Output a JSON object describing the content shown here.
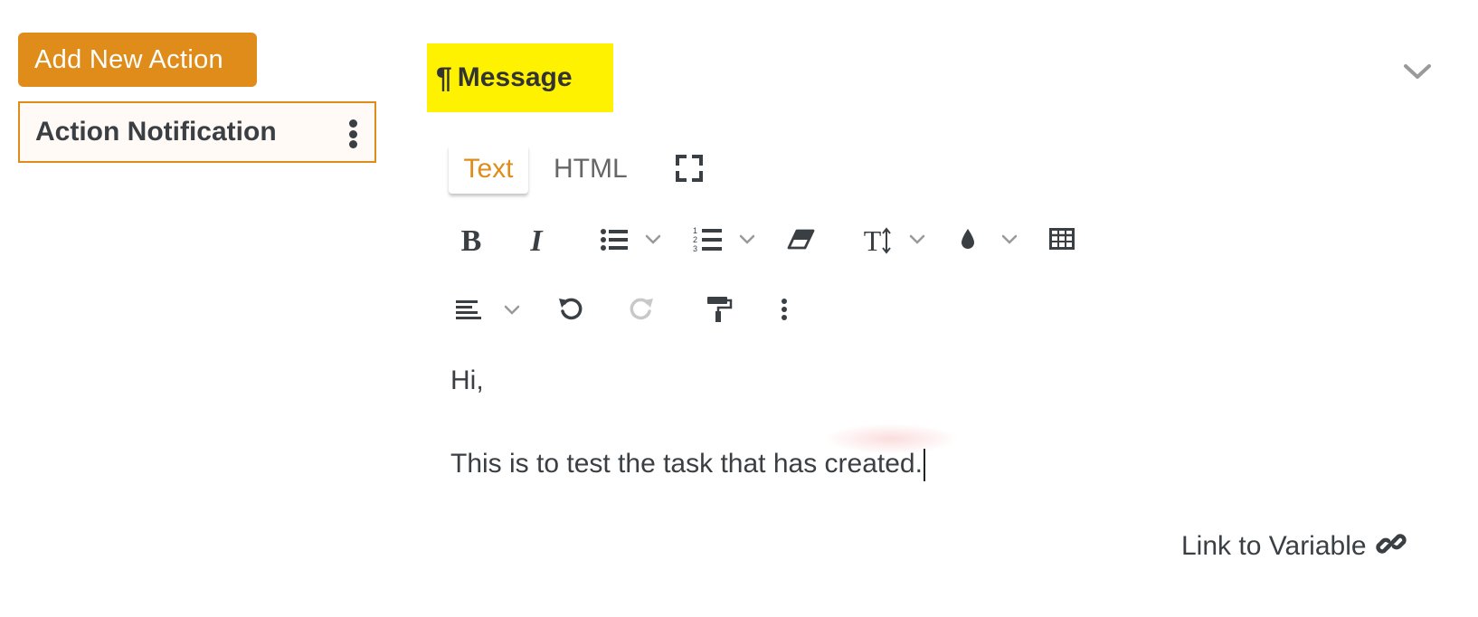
{
  "sidebar": {
    "add_button_label": "Add New Action",
    "actions": [
      {
        "label": "Action Notification",
        "menu_icon": "kebab-menu-icon"
      }
    ]
  },
  "section": {
    "icon": "paragraph-icon",
    "pilcrow": "¶",
    "title": "Message",
    "highlight_color": "#fff200",
    "collapse_icon": "chevron-down-icon"
  },
  "editor": {
    "tabs": [
      {
        "label": "Text",
        "active": true
      },
      {
        "label": "HTML",
        "active": false
      }
    ],
    "fullscreen_icon": "fullscreen-icon",
    "toolbar_row1": [
      {
        "name": "bold",
        "glyph": "B"
      },
      {
        "name": "italic",
        "glyph": "I"
      },
      {
        "name": "bullet-list",
        "icon": "bulleted-list-icon"
      },
      {
        "name": "numbered-list",
        "icon": "numbered-list-icon"
      },
      {
        "name": "clear-format",
        "icon": "eraser-icon"
      },
      {
        "name": "text-size",
        "glyph": "T"
      },
      {
        "name": "text-color",
        "icon": "ink-drop-icon"
      },
      {
        "name": "table",
        "icon": "table-icon"
      }
    ],
    "toolbar_row2": [
      {
        "name": "align",
        "icon": "align-left-icon"
      },
      {
        "name": "undo",
        "icon": "undo-icon"
      },
      {
        "name": "redo",
        "icon": "redo-icon",
        "disabled": true
      },
      {
        "name": "format-painter",
        "icon": "paint-roller-icon"
      },
      {
        "name": "more",
        "icon": "more-vertical-icon"
      }
    ],
    "content": {
      "line1": "Hi,",
      "line2": "This is to test the task that has created."
    }
  },
  "footer": {
    "link_label": "Link to Variable",
    "link_icon": "link-icon"
  },
  "colors": {
    "accent": "#e08c1a",
    "text": "#3a3f44",
    "muted": "#9a9a9a"
  }
}
